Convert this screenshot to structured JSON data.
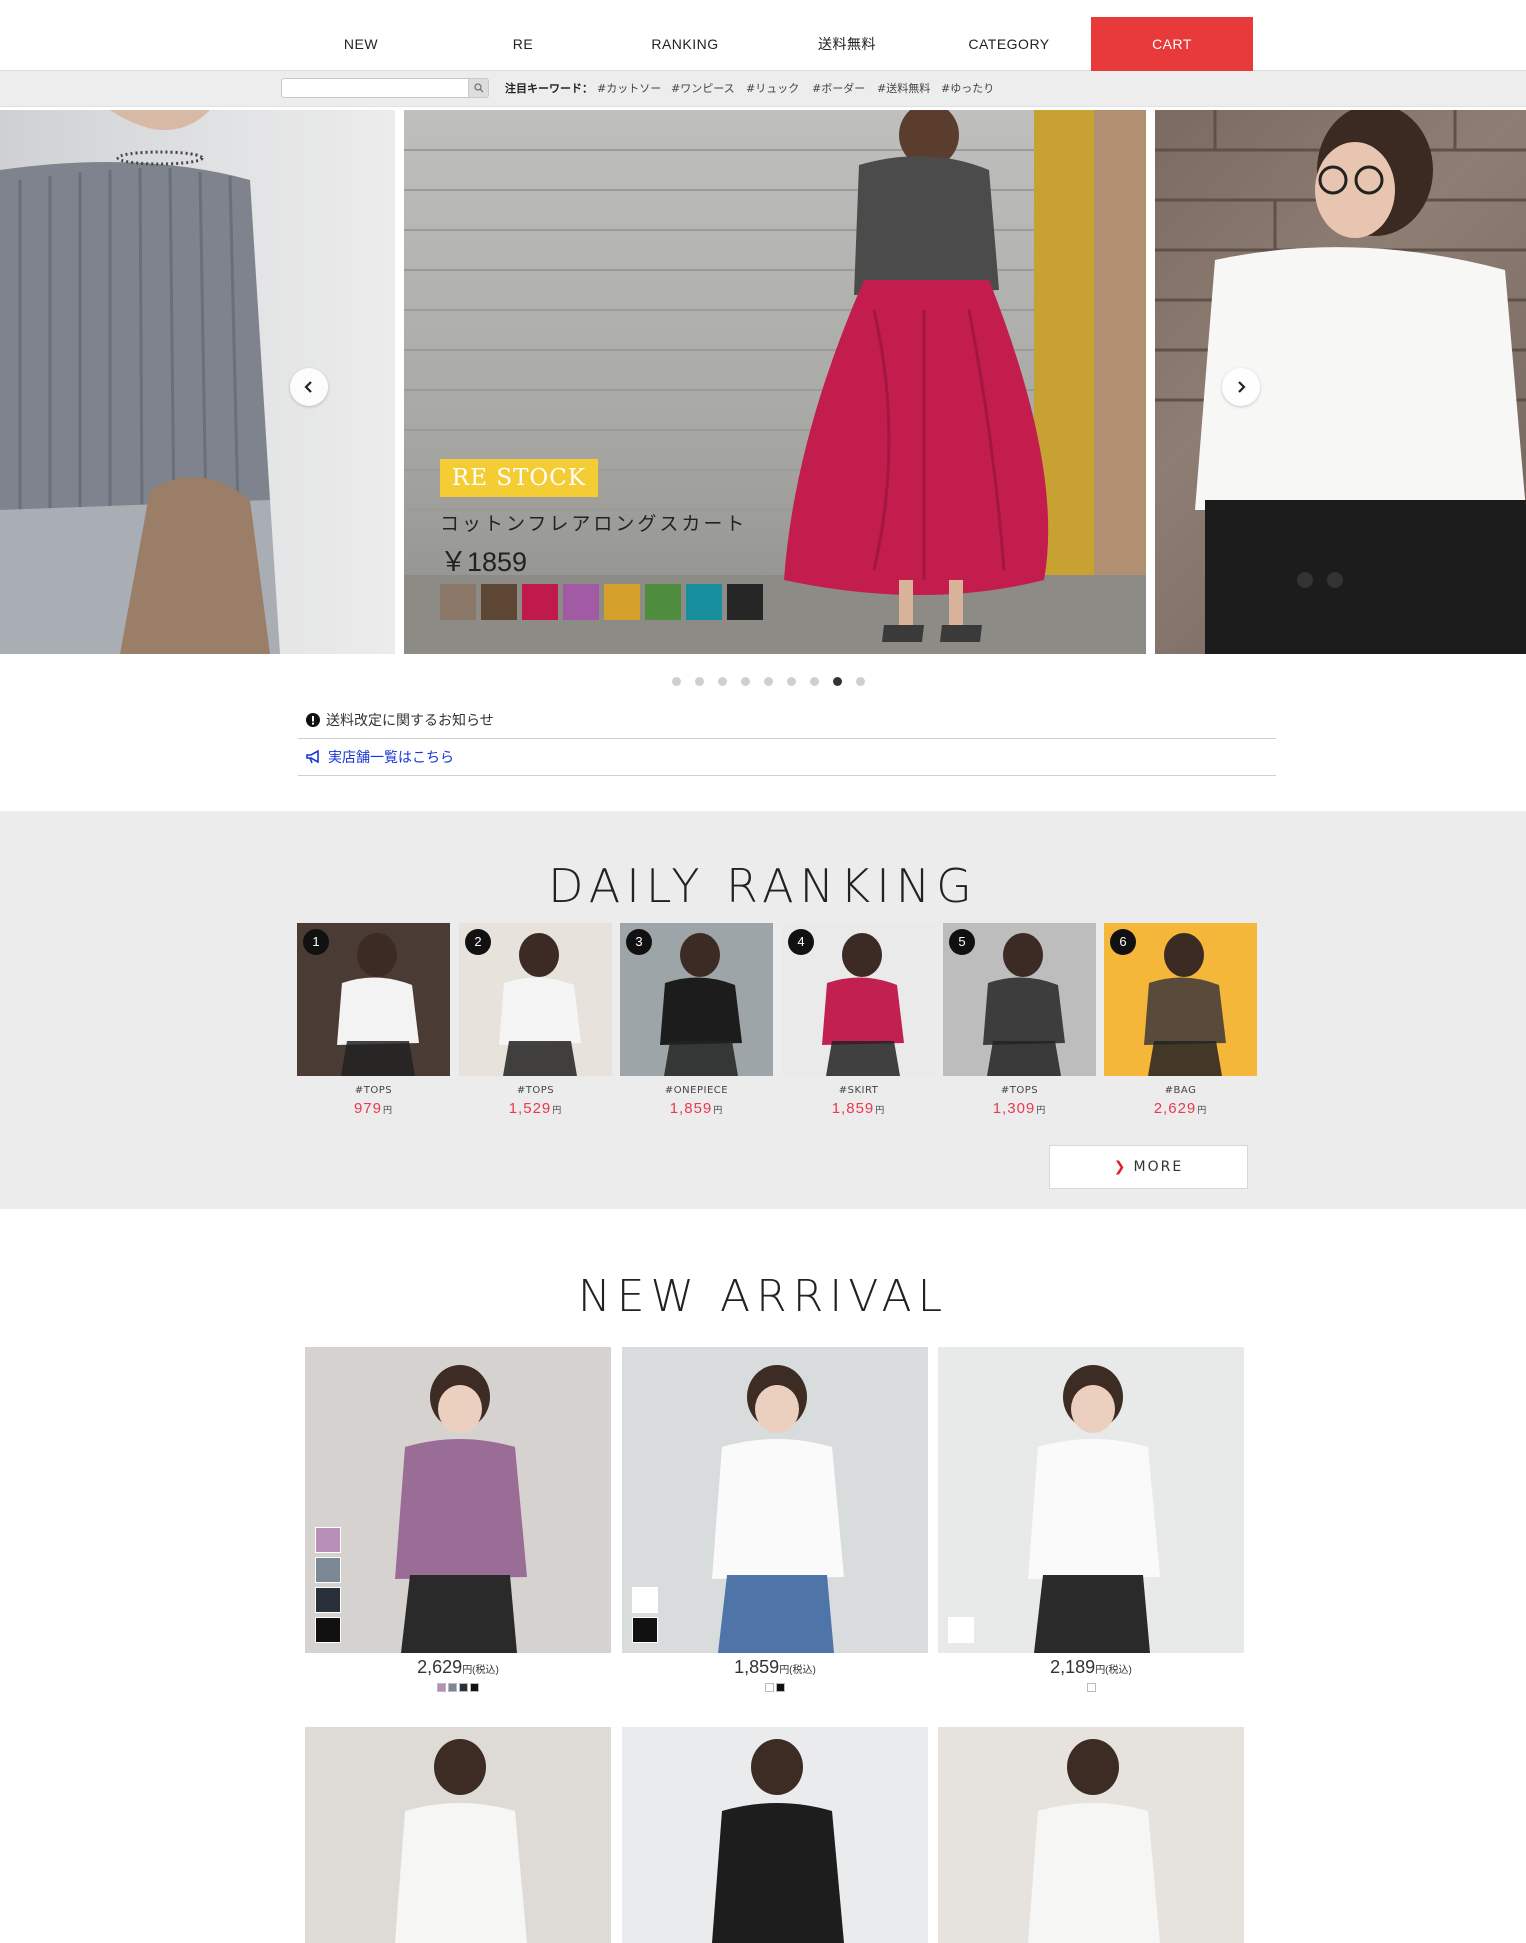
{
  "nav": {
    "items": [
      "NEW",
      "RE",
      "RANKING",
      "送料無料",
      "CATEGORY"
    ],
    "cart": "CART"
  },
  "keywords": {
    "label": "注目キーワード：",
    "search_placeholder": "",
    "tags": [
      "#カットソー",
      "#ワンピース",
      "#リュック",
      "#ボーダー",
      "#送料無料",
      "#ゆったり"
    ]
  },
  "hero": {
    "badge": "RE STOCK",
    "title": "コットンフレアロングスカート",
    "price": "￥1859",
    "swatches": [
      "#8b7767",
      "#5e4635",
      "#c01a4c",
      "#a35aa5",
      "#d5a02c",
      "#4f8d3e",
      "#178e9d",
      "#262626"
    ],
    "dots": 9,
    "active_dot": 7
  },
  "notices": {
    "shipping": "送料改定に関するお知らせ",
    "stores": "実店舗一覧はこちら"
  },
  "ranking": {
    "title": "DAILY RANKING",
    "yen": "円",
    "items": [
      {
        "rank": "1",
        "category": "#TOPS",
        "price": "979",
        "bg": "#4a3b35",
        "accent": "#f3f3f3"
      },
      {
        "rank": "2",
        "category": "#TOPS",
        "price": "1,529",
        "bg": "#e7e2dc",
        "accent": "#f5f5f5"
      },
      {
        "rank": "3",
        "category": "#ONEPIECE",
        "price": "1,859",
        "bg": "#9ea5a9",
        "accent": "#1c1c1c"
      },
      {
        "rank": "4",
        "category": "#SKIRT",
        "price": "1,859",
        "bg": "#eaeaea",
        "accent": "#c22050"
      },
      {
        "rank": "5",
        "category": "#TOPS",
        "price": "1,309",
        "bg": "#bdbdbd",
        "accent": "#3d3d3d"
      },
      {
        "rank": "6",
        "category": "#BAG",
        "price": "2,629",
        "bg": "#f4b73a",
        "accent": "#5a4a3a"
      }
    ],
    "more": "MORE"
  },
  "arrival": {
    "title": "NEW ARRIVAL",
    "items": [
      {
        "price": "2,629",
        "unit": "円(税込)",
        "bg": "#d6d2d0",
        "colors": [
          "#b88fb6",
          "#7d8896",
          "#2a2f3c",
          "#111111"
        ]
      },
      {
        "price": "1,859",
        "unit": "円(税込)",
        "bg": "#d9dcdd",
        "colors": [
          "#ffffff",
          "#111111"
        ]
      },
      {
        "price": "2,189",
        "unit": "円(税込)",
        "bg": "#e8eaea",
        "colors": [
          "#ffffff"
        ]
      }
    ],
    "row2": [
      {
        "bg": "#dedbd7"
      },
      {
        "bg": "#e9ebec"
      },
      {
        "bg": "#e6e3df"
      }
    ]
  }
}
